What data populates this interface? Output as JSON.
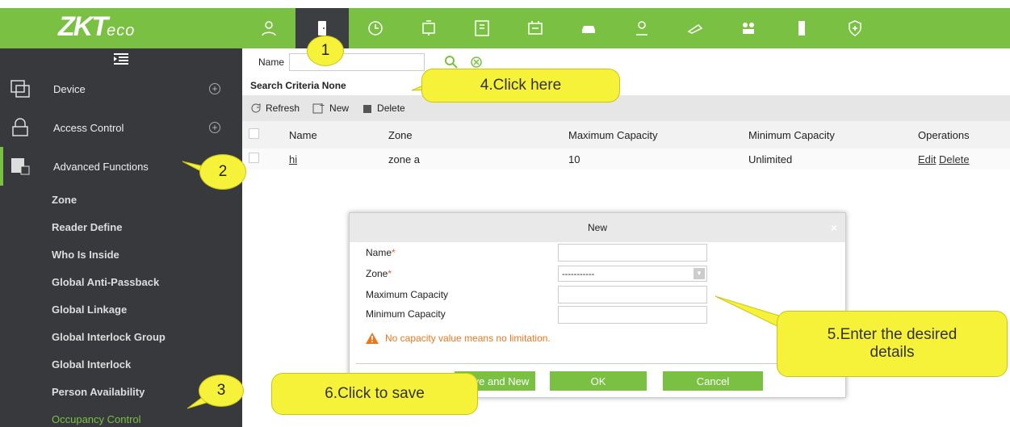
{
  "brand": {
    "logo_main": "ZKT",
    "logo_suffix": "eco",
    "accent": "#7ac143",
    "sidebar_bg": "#37393c"
  },
  "modules": [
    "personnel-icon",
    "access-door-icon",
    "attendance-clock-icon",
    "elevator-icon",
    "parking-icon",
    "visitor-icon",
    "patrol-car-icon",
    "guard-icon",
    "video-icon",
    "org-icon",
    "consumer-icon",
    "security-shield-icon"
  ],
  "sidebar": {
    "menus": [
      {
        "label": "Device",
        "toggle": "+"
      },
      {
        "label": "Access Control",
        "toggle": "+"
      },
      {
        "label": "Advanced Functions",
        "toggle": "−"
      }
    ],
    "items": [
      "Zone",
      "Reader Define",
      "Who Is Inside",
      "Global Anti-Passback",
      "Global Linkage",
      "Global Interlock Group",
      "Global Interlock",
      "Person Availability",
      "Occupancy Control"
    ]
  },
  "search": {
    "label": "Name",
    "criteria": "Search Criteria None"
  },
  "toolbar": {
    "refresh": "Refresh",
    "new": "New",
    "delete": "Delete"
  },
  "table": {
    "headers": [
      "Name",
      "Zone",
      "Maximum Capacity",
      "Minimum Capacity",
      "Operations"
    ],
    "rows": [
      {
        "name": "hi",
        "zone": "zone a",
        "max": "10",
        "min": "Unlimited",
        "edit": "Edit",
        "delete": "Delete"
      }
    ]
  },
  "dialog": {
    "title": "New",
    "close": "×",
    "fields": [
      "Name",
      "Zone",
      "Maximum Capacity",
      "Minimum Capacity"
    ],
    "required": "*",
    "zone_value": "-----------",
    "warning": "No capacity value means no limitation.",
    "buttons": {
      "save_new": "Save and New",
      "ok": "OK",
      "cancel": "Cancel"
    }
  },
  "callouts": {
    "b1": "1",
    "b2": "2",
    "b3": "3",
    "c4": "4.Click here",
    "c5": "5.Enter the desired details",
    "c6": "6.Click to save"
  }
}
